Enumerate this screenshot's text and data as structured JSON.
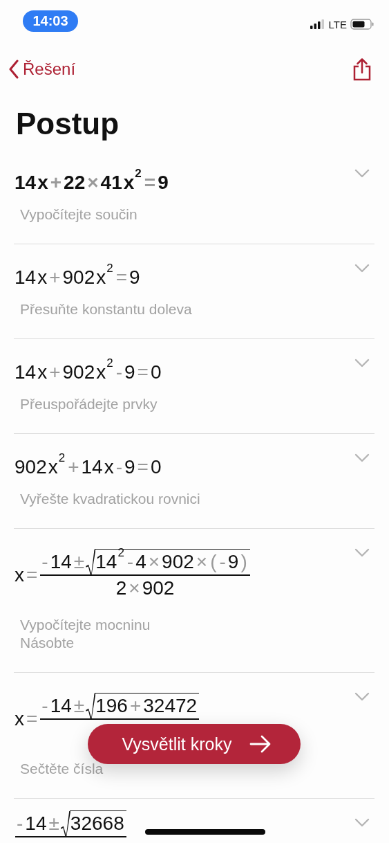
{
  "status_bar": {
    "time": "14:03",
    "network": "LTE"
  },
  "nav": {
    "back_label": "Řešení"
  },
  "title": "Postup",
  "steps": [
    {
      "highlighted": true,
      "expr": [
        {
          "kind": "num",
          "text": "14"
        },
        {
          "kind": "num",
          "text": "x"
        },
        {
          "kind": "op",
          "text": "+"
        },
        {
          "kind": "num",
          "text": "22"
        },
        {
          "kind": "op",
          "text": "×"
        },
        {
          "kind": "num",
          "text": "41"
        },
        {
          "kind": "num",
          "text": "x"
        },
        {
          "kind": "sup",
          "text": "2"
        },
        {
          "kind": "op",
          "text": "="
        },
        {
          "kind": "num",
          "text": "9"
        }
      ],
      "descriptions": [
        "Vypočítejte součin"
      ]
    },
    {
      "highlighted": false,
      "expr": [
        {
          "kind": "num",
          "text": "14"
        },
        {
          "kind": "num",
          "text": "x"
        },
        {
          "kind": "op",
          "text": "+"
        },
        {
          "kind": "num",
          "text": "902"
        },
        {
          "kind": "num",
          "text": "x"
        },
        {
          "kind": "sup",
          "text": "2"
        },
        {
          "kind": "op",
          "text": "="
        },
        {
          "kind": "num",
          "text": "9"
        }
      ],
      "descriptions": [
        "Přesuňte konstantu doleva"
      ]
    },
    {
      "highlighted": false,
      "expr": [
        {
          "kind": "num",
          "text": "14"
        },
        {
          "kind": "num",
          "text": "x"
        },
        {
          "kind": "op",
          "text": "+"
        },
        {
          "kind": "num",
          "text": "902"
        },
        {
          "kind": "num",
          "text": "x"
        },
        {
          "kind": "sup",
          "text": "2"
        },
        {
          "kind": "op",
          "text": "-"
        },
        {
          "kind": "num",
          "text": "9"
        },
        {
          "kind": "op",
          "text": "="
        },
        {
          "kind": "num",
          "text": "0"
        }
      ],
      "descriptions": [
        "Přeuspořádejte prvky"
      ]
    },
    {
      "highlighted": false,
      "expr": [
        {
          "kind": "num",
          "text": "902"
        },
        {
          "kind": "num",
          "text": "x"
        },
        {
          "kind": "sup",
          "text": "2"
        },
        {
          "kind": "op",
          "text": "+"
        },
        {
          "kind": "num",
          "text": "14"
        },
        {
          "kind": "num",
          "text": "x"
        },
        {
          "kind": "op",
          "text": "-"
        },
        {
          "kind": "num",
          "text": "9"
        },
        {
          "kind": "op",
          "text": "="
        },
        {
          "kind": "num",
          "text": "0"
        }
      ],
      "descriptions": [
        "Vyřešte kvadratickou rovnici"
      ]
    },
    {
      "highlighted": false,
      "expr": [
        {
          "kind": "num",
          "text": "x"
        },
        {
          "kind": "op",
          "text": "="
        },
        {
          "kind": "frac",
          "num": [
            {
              "kind": "op",
              "text": "-"
            },
            {
              "kind": "num",
              "text": "14"
            },
            {
              "kind": "op",
              "text": "±"
            },
            {
              "kind": "sqrt",
              "body": [
                {
                  "kind": "num",
                  "text": "14"
                },
                {
                  "kind": "sup",
                  "text": "2"
                },
                {
                  "kind": "op",
                  "text": "-"
                },
                {
                  "kind": "num",
                  "text": "4"
                },
                {
                  "kind": "op",
                  "text": "×"
                },
                {
                  "kind": "num",
                  "text": "902"
                },
                {
                  "kind": "op",
                  "text": "×"
                },
                {
                  "kind": "op",
                  "text": "("
                },
                {
                  "kind": "op",
                  "text": "-"
                },
                {
                  "kind": "num",
                  "text": "9"
                },
                {
                  "kind": "op",
                  "text": ")"
                }
              ]
            }
          ],
          "den": [
            {
              "kind": "num",
              "text": "2"
            },
            {
              "kind": "op",
              "text": "×"
            },
            {
              "kind": "num",
              "text": "902"
            }
          ]
        }
      ],
      "descriptions": [
        "Vypočítejte mocninu",
        "Násobte"
      ]
    },
    {
      "highlighted": false,
      "expr": [
        {
          "kind": "num",
          "text": "x"
        },
        {
          "kind": "op",
          "text": "="
        },
        {
          "kind": "frac",
          "num": [
            {
              "kind": "op",
              "text": "-"
            },
            {
              "kind": "num",
              "text": "14"
            },
            {
              "kind": "op",
              "text": "±"
            },
            {
              "kind": "sqrt",
              "body": [
                {
                  "kind": "num",
                  "text": "196"
                },
                {
                  "kind": "op",
                  "text": "+"
                },
                {
                  "kind": "num",
                  "text": "32472"
                }
              ]
            }
          ]
        }
      ],
      "descriptions": [
        "Sečtěte čísla"
      ]
    },
    {
      "highlighted": false,
      "expr": [
        {
          "kind": "frac",
          "num": [
            {
              "kind": "op",
              "text": "-"
            },
            {
              "kind": "num",
              "text": "14"
            },
            {
              "kind": "op",
              "text": "±"
            },
            {
              "kind": "sqrt",
              "body": [
                {
                  "kind": "num",
                  "text": "32668"
                }
              ]
            }
          ]
        }
      ]
    }
  ],
  "action_button": {
    "label": "Vysvětlit kroky"
  }
}
